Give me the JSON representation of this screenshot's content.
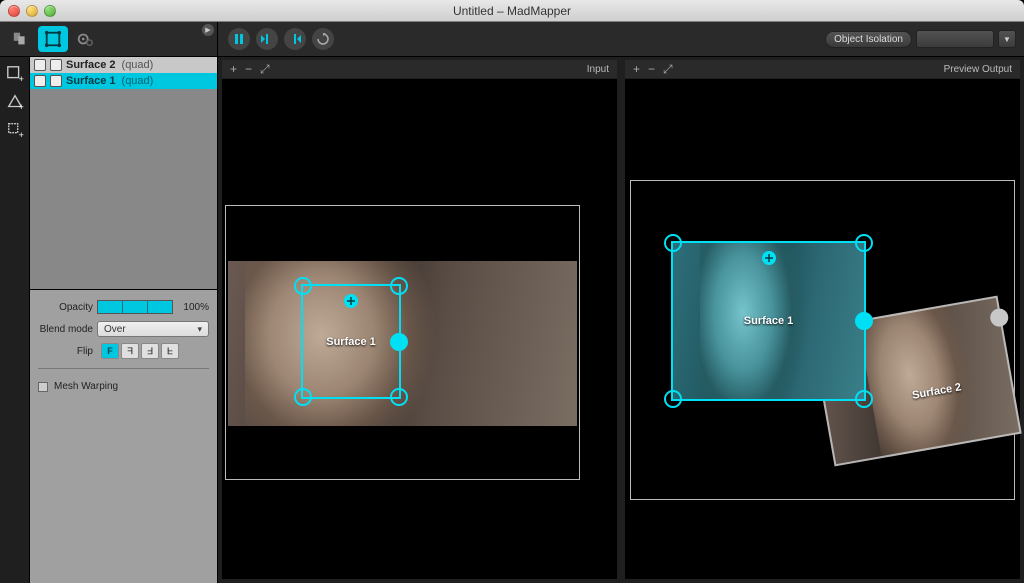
{
  "window": {
    "title": "Untitled – MadMapper"
  },
  "toolbar": {
    "object_isolation_label": "Object Isolation"
  },
  "panes": {
    "input_label": "Input",
    "preview_label": "Preview Output"
  },
  "surfaces": [
    {
      "name": "Surface 2",
      "type": "(quad)",
      "selected": false
    },
    {
      "name": "Surface 1",
      "type": "(quad)",
      "selected": true
    }
  ],
  "properties": {
    "opacity_label": "Opacity",
    "opacity_value": "100%",
    "blend_label": "Blend mode",
    "blend_value": "Over",
    "flip_label": "Flip",
    "flip_buttons": [
      "F",
      "ᖷ",
      "ᖵ",
      "ᖶ"
    ],
    "mesh_warp_label": "Mesh Warping"
  },
  "canvas": {
    "surface1_label": "Surface 1",
    "surface2_label": "Surface 2"
  }
}
